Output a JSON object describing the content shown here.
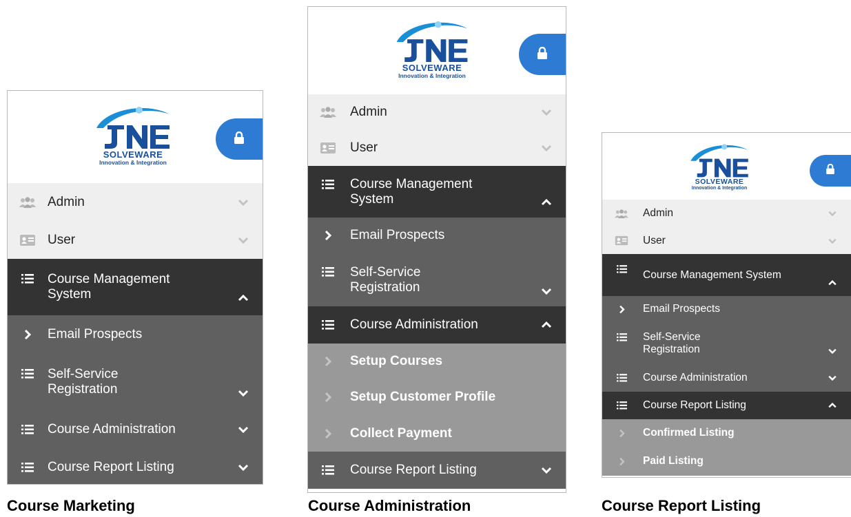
{
  "colors": {
    "brand_blue": "#1a4f9c",
    "lock_blue": "#2e7bd3",
    "menu_dark": "#333333",
    "submenu": "#606060",
    "submenu_light": "#999999",
    "top_bg": "#efefef"
  },
  "logo": {
    "name": "SOLVEWARE",
    "tagline": "Innovation & Integration"
  },
  "panels": [
    {
      "caption": "Course Marketing",
      "items": [
        {
          "label": "Admin",
          "icon": "users-icon",
          "chevron": "down"
        },
        {
          "label": "User",
          "icon": "id-card-icon",
          "chevron": "down"
        },
        {
          "label": "Course Management System",
          "icon": "list-icon",
          "chevron": "up"
        },
        {
          "label": "Email Prospects",
          "icon": "chevron-right-icon"
        },
        {
          "label": "Self-Service Registration",
          "icon": "list-icon",
          "chevron": "down"
        },
        {
          "label": "Course Administration",
          "icon": "list-icon",
          "chevron": "down"
        },
        {
          "label": "Course Report Listing",
          "icon": "list-icon",
          "chevron": "down"
        }
      ]
    },
    {
      "caption": "Course Administration",
      "items": [
        {
          "label": "Admin",
          "icon": "users-icon",
          "chevron": "down"
        },
        {
          "label": "User",
          "icon": "id-card-icon",
          "chevron": "down"
        },
        {
          "label": "Course Management System",
          "icon": "list-icon",
          "chevron": "up"
        },
        {
          "label": "Email Prospects",
          "icon": "chevron-right-icon"
        },
        {
          "label": "Self-Service Registration",
          "icon": "list-icon",
          "chevron": "down"
        },
        {
          "label": "Course Administration",
          "icon": "list-icon",
          "chevron": "up"
        },
        {
          "label": "Setup Courses",
          "icon": "chevron-right-icon"
        },
        {
          "label": "Setup Customer Profile",
          "icon": "chevron-right-icon"
        },
        {
          "label": "Collect Payment",
          "icon": "chevron-right-icon"
        },
        {
          "label": "Course Report Listing",
          "icon": "list-icon",
          "chevron": "down"
        }
      ]
    },
    {
      "caption": "Course Report Listing",
      "items": [
        {
          "label": "Admin",
          "icon": "users-icon",
          "chevron": "down"
        },
        {
          "label": "User",
          "icon": "id-card-icon",
          "chevron": "down"
        },
        {
          "label": "Course Management System",
          "icon": "list-icon",
          "chevron": "up"
        },
        {
          "label": "Email Prospects",
          "icon": "chevron-right-icon"
        },
        {
          "label": "Self-Service Registration",
          "icon": "list-icon",
          "chevron": "down"
        },
        {
          "label": "Course Administration",
          "icon": "list-icon",
          "chevron": "down"
        },
        {
          "label": "Course Report Listing",
          "icon": "list-icon",
          "chevron": "up"
        },
        {
          "label": "Confirmed Listing",
          "icon": "chevron-right-icon"
        },
        {
          "label": "Paid Listing",
          "icon": "chevron-right-icon"
        }
      ]
    }
  ]
}
